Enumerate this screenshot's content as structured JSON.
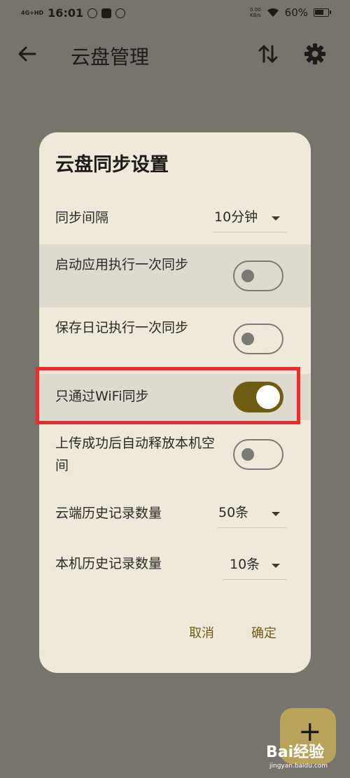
{
  "status_bar": {
    "signal": "4G+HD",
    "time": "16:01",
    "net_speed_value": "0.00",
    "net_speed_unit": "KB/s",
    "battery": "60%"
  },
  "app_bar": {
    "title": "云盘管理",
    "icons": [
      "back-arrow-icon",
      "sort-icon",
      "gear-icon"
    ]
  },
  "dialog": {
    "title": "云盘同步设置",
    "sync_interval": {
      "label": "同步间隔",
      "value": "10分钟"
    },
    "sync_on_start": {
      "label": "启动应用执行一次同步",
      "checked": false
    },
    "sync_on_save": {
      "label": "保存日记执行一次同步",
      "checked": false
    },
    "wifi_only": {
      "label": "只通过WiFi同步",
      "checked": true
    },
    "auto_free_space": {
      "label": "上传成功后自动释放本机空间",
      "checked": false
    },
    "cloud_history": {
      "label": "云端历史记录数量",
      "value": "50条"
    },
    "local_history": {
      "label": "本机历史记录数量",
      "value": "10条"
    },
    "cancel_label": "取消",
    "confirm_label": "确定"
  },
  "fab": {
    "symbol": "+"
  },
  "watermark": {
    "text": "Bai经验",
    "sub": "jingyan.baidu.com"
  },
  "colors": {
    "scrim": "#77746e",
    "dialog_bg": "#efe9dc",
    "accent": "#6e5c12",
    "highlight": "#f4292c"
  }
}
